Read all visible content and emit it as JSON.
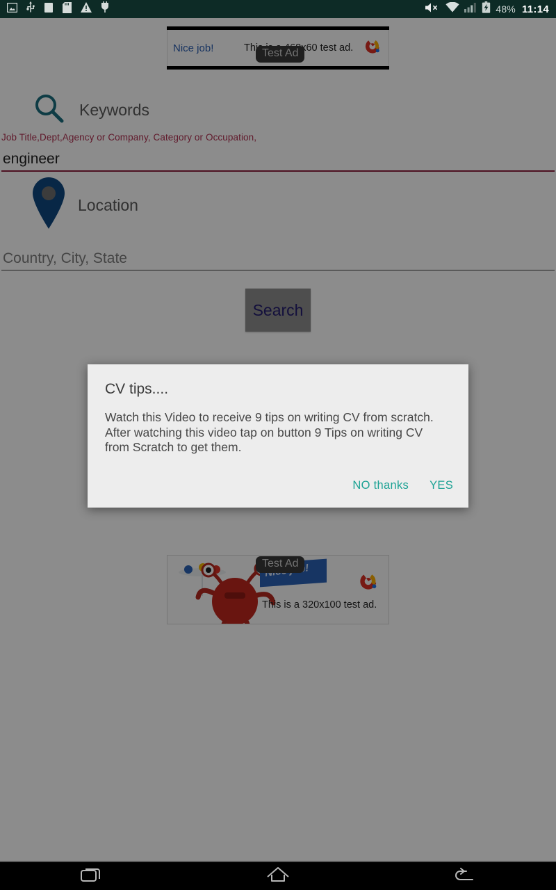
{
  "statusbar": {
    "left_icons": [
      "image-icon",
      "usb-icon",
      "sdcard-blank-icon",
      "sdcard-icon",
      "warning-icon",
      "usb-plug-icon"
    ],
    "right_icons": [
      "volume-mute-icon",
      "wifi-icon",
      "signal-icon",
      "battery-charging-icon"
    ],
    "battery": "48%",
    "clock": "11:14"
  },
  "ad_top": {
    "label": "Test Ad",
    "headline": "Nice job!",
    "description": "This is a 468x60 test ad.",
    "logo": "admob-logo"
  },
  "form": {
    "keywords": {
      "icon": "search-icon",
      "label": "Keywords",
      "hint": "Job Title,Dept,Agency or Company, Category or Occupation,",
      "value": "engineer",
      "placeholder": ""
    },
    "location": {
      "icon": "map-pin-icon",
      "label": "Location",
      "value": "",
      "placeholder": "Country, City, State"
    },
    "search_button": "Search"
  },
  "dialog": {
    "title": "CV tips....",
    "body": "Watch this Video to receive 9 tips on writing CV from scratch. After watching this video tap on button 9 Tips on writing CV from Scratch to get them.",
    "negative_button": "NO thanks",
    "positive_button": "YES"
  },
  "ad_bottom": {
    "label": "Test Ad",
    "ribbon_text": "Nice job!",
    "description": "This is a 320x100 test ad.",
    "logo": "admob-logo",
    "character": "red-monster-illustration"
  },
  "navbar": {
    "recents": "recents-icon",
    "home": "home-icon",
    "back": "back-icon"
  },
  "colors": {
    "status_bar": "#0d2b26",
    "accent_teal": "#1ca294",
    "hint_red": "#b03050",
    "underline_red": "#8d1f3f",
    "pin_blue": "#0f4880",
    "search_text": "#241d6e"
  }
}
